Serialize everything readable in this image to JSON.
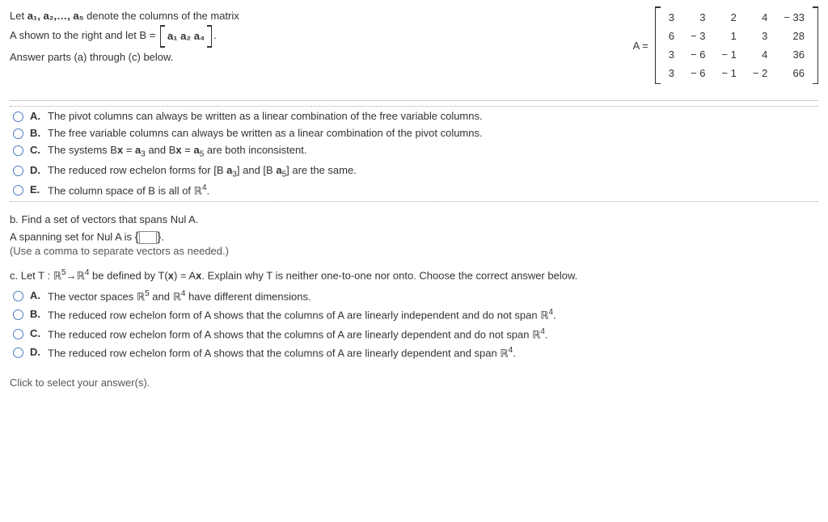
{
  "problem": {
    "line1_pre": "Let ",
    "line1_vars": "a₁, a₂,…, a₅",
    "line1_post": " denote the columns of the matrix",
    "line2_pre": "A shown to the right and let B = ",
    "line2_matrix": "a₁  a₂  a₄",
    "line2_post": ".",
    "line3": "Answer parts (a) through (c) below."
  },
  "matrixA": {
    "label": "A =",
    "rows": [
      [
        "3",
        "3",
        "2",
        "4",
        "− 33"
      ],
      [
        "6",
        "− 3",
        "1",
        "3",
        "28"
      ],
      [
        "3",
        "− 6",
        "− 1",
        "4",
        "36"
      ],
      [
        "3",
        "− 6",
        "− 1",
        "− 2",
        "66"
      ]
    ]
  },
  "groupA": {
    "options": [
      {
        "letter": "A.",
        "text": "The pivot columns can always be written as a linear combination of the free variable columns."
      },
      {
        "letter": "B.",
        "text": "The free variable columns can always be written as a linear combination of the pivot columns."
      },
      {
        "letter": "C.",
        "text_html": "The systems B<b>x</b> = <b>a</b><span class='sub'>3</span> and B<b>x</b> = <b>a</b><span class='sub'>5</span> are both inconsistent."
      },
      {
        "letter": "D.",
        "text_html": "The reduced row echelon forms for [B <b>a</b><span class='sub'>3</span>] and [B <b>a</b><span class='sub'>5</span>] are the same."
      },
      {
        "letter": "E.",
        "text_html": "The column space of B is all of <span class='dbl'>ℝ</span><span class='sup'>4</span>."
      }
    ]
  },
  "partB": {
    "prompt": "b. Find a set of vectors that spans Nul A.",
    "answer_pre": "A spanning set for Nul A is ",
    "answer_post": ".",
    "hint": "(Use a comma to separate vectors as needed.)"
  },
  "partC": {
    "prompt_html": "c. Let T : <span class='dbl'>ℝ</span><span class='sup'>5</span>→<span class='dbl'>ℝ</span><span class='sup'>4</span> be defined by T(<b>x</b>) = A<b>x</b>. Explain why T is neither one-to-one nor onto. Choose the correct answer below.",
    "options": [
      {
        "letter": "A.",
        "text_html": "The vector spaces <span class='dbl'>ℝ</span><span class='sup'>5</span> and <span class='dbl'>ℝ</span><span class='sup'>4</span> have different dimensions."
      },
      {
        "letter": "B.",
        "text_html": "The reduced row echelon form of A shows that the columns of A are linearly independent and do not span <span class='dbl'>ℝ</span><span class='sup'>4</span>."
      },
      {
        "letter": "C.",
        "text_html": "The reduced row echelon form of A shows that the columns of A are linearly dependent and do not span <span class='dbl'>ℝ</span><span class='sup'>4</span>."
      },
      {
        "letter": "D.",
        "text_html": "The reduced row echelon form of A shows that the columns of A are linearly dependent and span <span class='dbl'>ℝ</span><span class='sup'>4</span>."
      }
    ]
  },
  "footer": "Click to select your answer(s)."
}
